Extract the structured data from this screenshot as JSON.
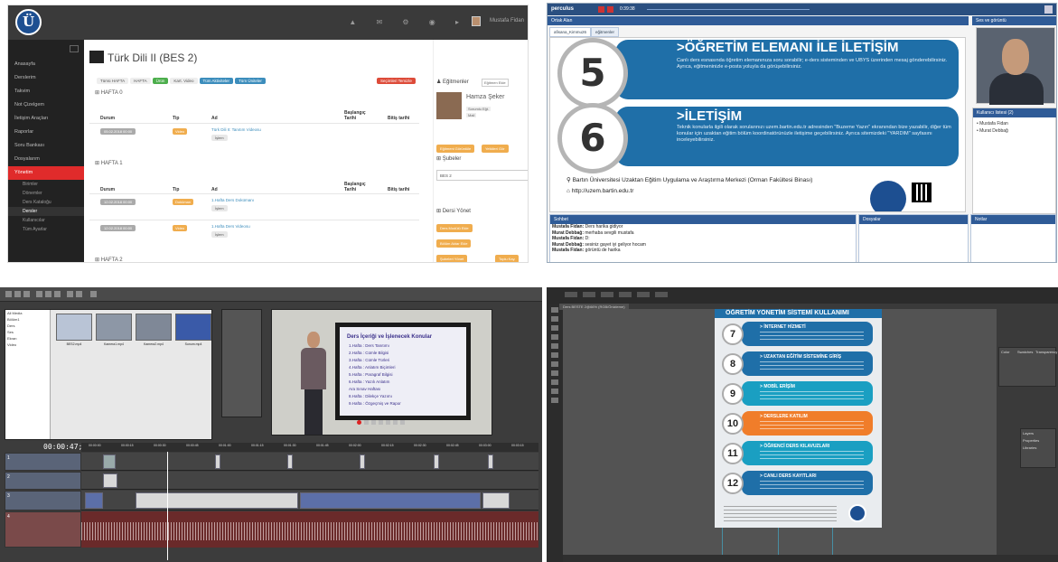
{
  "lms": {
    "user": "Mustafa Fidan",
    "sidebar": [
      {
        "label": "Anasayfa"
      },
      {
        "label": "Derslerim"
      },
      {
        "label": "Takvim"
      },
      {
        "label": "Not Çizelgem"
      },
      {
        "label": "İletişim Araçları"
      },
      {
        "label": "Raporlar"
      },
      {
        "label": "Soru Bankası"
      },
      {
        "label": "Dosyalarım"
      },
      {
        "label": "Yönetim",
        "active": true
      }
    ],
    "sidebar_sub": [
      "Birimler",
      "Dönemler",
      "Ders Kataloğu",
      "Dersler",
      "Kullanıcılar",
      "Tüm Ayarlar"
    ],
    "course_title": "Türk Dili II (BES 2)",
    "filters": {
      "week": "Tümü HAFTA",
      "week2": "HAFTA",
      "active": "Ürün",
      "type": "Kart. Video",
      "activities": "Tüm Aktiviteler",
      "units": "Tüm Üniteler",
      "delete": "Seçimleri Temizle"
    },
    "weeks": [
      {
        "label": "HAFTA 0",
        "items": [
          {
            "date": "05.02.2018 00:00",
            "type": "Video",
            "name": "Türk Dili II: Tanıtım Videosu",
            "ops": "İşlem"
          }
        ]
      },
      {
        "label": "HAFTA 1",
        "items": [
          {
            "date": "12.02.2018 00:00",
            "type": "Doküman",
            "name": "1.Hafta Ders Dokümanı",
            "ops": "İşlem"
          },
          {
            "date": "12.02.2018 00:00",
            "type": "Video",
            "name": "1.Hafta Ders Videosu",
            "ops": "İşlem"
          }
        ]
      },
      {
        "label": "HAFTA 2",
        "items": []
      }
    ],
    "columns": {
      "status": "Durum",
      "type": "Tip",
      "name": "Ad",
      "start": "Başlangıç Tarihi",
      "end": "Bitiş tarihi"
    },
    "instructors_title": "Eğitmenler",
    "edit_instructor": "Eğitmen Ekle",
    "teacher": {
      "name": "Hamza Şeker",
      "role": "Sorumlu Eğt.",
      "mail": "Mail"
    },
    "btn_teacher": "Eğitmeni Görüntüle",
    "btn_edit": "Yetkileri Gör",
    "branches_title": "Şubeler",
    "branch_select": "BES 2",
    "manage_title": "Dersi Yönet",
    "manage_buttons": [
      "Ders Modülü Ekle",
      "Bölüm Aktar Ekle",
      "Şubeleri Yönet",
      "Toplu Kay."
    ]
  },
  "perculus": {
    "brand": "perculus",
    "timer": "0:39:38",
    "common_area": "Ortak Alan",
    "tabs": [
      "afisana_Kimmu26",
      "eğitmenler"
    ],
    "slide": {
      "n5": "5",
      "t5": "ÖĞRETİM ELEMANI İLE İLETİŞİM",
      "b5": "Canlı ders esnasında öğretim elemanınıza soru sorabilir; e-ders sisteminden ve UBYS üzerinden mesaj gönderebilirsiniz. Ayrıca, eğitmeninizle e-posta yoluyla da görüşebilirsiniz.",
      "n6": "6",
      "t6": "İLETİŞİM",
      "b6": "Teknik konularla ilgili olarak sorularınızı uzem.bartin.edu.tr adresinden \"Buzeme Yazın\" ekranından bize yazabilir, diğer tüm konular için uzaktan eğitim bölüm koordinatörünüzle iletişime geçebilirsiniz. Ayrıca sitemizdeki \"YARDIM\" sayfasını inceleyebilirsiniz.",
      "footer1": "Bartın Üniversitesi Uzaktan Eğitim Uygulama ve Araştırma Merkezi (Orman Fakültesi Binası)",
      "footer2": "http://uzem.bartin.edu.tr"
    },
    "cam_title": "Ses ve görüntü",
    "users_title": "Kullanıcı listesi (2)",
    "users": [
      "Mustafa Fidan",
      "Murat Debbağ"
    ],
    "chat_title": "Sohbet",
    "chat": [
      {
        "who": "Mustafa Fidan:",
        "msg": "Ders harika gidiyor"
      },
      {
        "who": "Murat Debbağ:",
        "msg": "merhaba sevgili mustafa"
      },
      {
        "who": "Mustafa Fidan:",
        "msg": "D:"
      },
      {
        "who": "Murat Debbağ:",
        "msg": "sesiniz gayet iyi geliyor hocam"
      },
      {
        "who": "Mustafa Fidan:",
        "msg": "görüntü de harika"
      }
    ],
    "files_title": "Dosyalar",
    "notes_title": "Notlar"
  },
  "editor": {
    "tree": [
      "All Media",
      "Bölüm1",
      "Ders",
      "Ses",
      "Ekran",
      "Video"
    ],
    "thumbs": [
      "BES2.mp4",
      "Kamera1.mp4",
      "Kamera2.mp4",
      "Sunum.mp4"
    ],
    "timecode": "00:00:47;10",
    "ruler": [
      "00:00:00",
      "00:00:15",
      "00:00:30",
      "00:00:45",
      "00:01:00",
      "00:01:15",
      "00:01:30",
      "00:01:45",
      "00:02:00",
      "00:02:15",
      "00:02:30",
      "00:02:45",
      "00:03:00",
      "00:03:15"
    ],
    "tracks": [
      "1",
      "2",
      "3",
      "4"
    ],
    "tv_title": "Ders İçeriği ve İşlenecek Konular",
    "tv_lines": [
      "1.Hafta  : Ders Tanıtımı",
      "2.Hafta  : Cümle Bilgisi",
      "3.Hafta  : Cümle Türleri",
      "4.Hafta  : Anlatım Biçimleri",
      "5.Hafta  : Paragraf Bilgisi",
      "6.Hafta  : Yazılı Anlatım",
      "Ara Sınav Haftası",
      "8.Hafta  : Dilekçe Yazımı",
      "9.Hafta  : Özgeçmiş ve Rapor"
    ]
  },
  "illustrator": {
    "doc_tab": "Ders BESTE 2@66% (RGB/Önizleme)",
    "poster_title": "ÖĞRETİM YÖNETİM SİSTEMİ KULLANIMI",
    "items": [
      {
        "num": "7",
        "title": "İNTERNET HİZMETİ",
        "color": "#1f6fa8"
      },
      {
        "num": "8",
        "title": "UZAKTAN EĞİTİM SİSTEMİNE GİRİŞ",
        "color": "#1f6fa8"
      },
      {
        "num": "9",
        "title": "MOBİL ERİŞİM",
        "color": "#1a9fc2"
      },
      {
        "num": "10",
        "title": "DERSLERE KATILIM",
        "color": "#f07d2a"
      },
      {
        "num": "11",
        "title": "ÖĞRENCİ DERS KILAVUZLARI",
        "color": "#1a9fc2"
      },
      {
        "num": "12",
        "title": "CANLI DERS KAYITLARI",
        "color": "#1f6fa8"
      }
    ],
    "panels": [
      "Color",
      "Swatches",
      "Transparency",
      "Layers",
      "Properties",
      "Libraries"
    ],
    "accent": "#3fb6d8"
  }
}
